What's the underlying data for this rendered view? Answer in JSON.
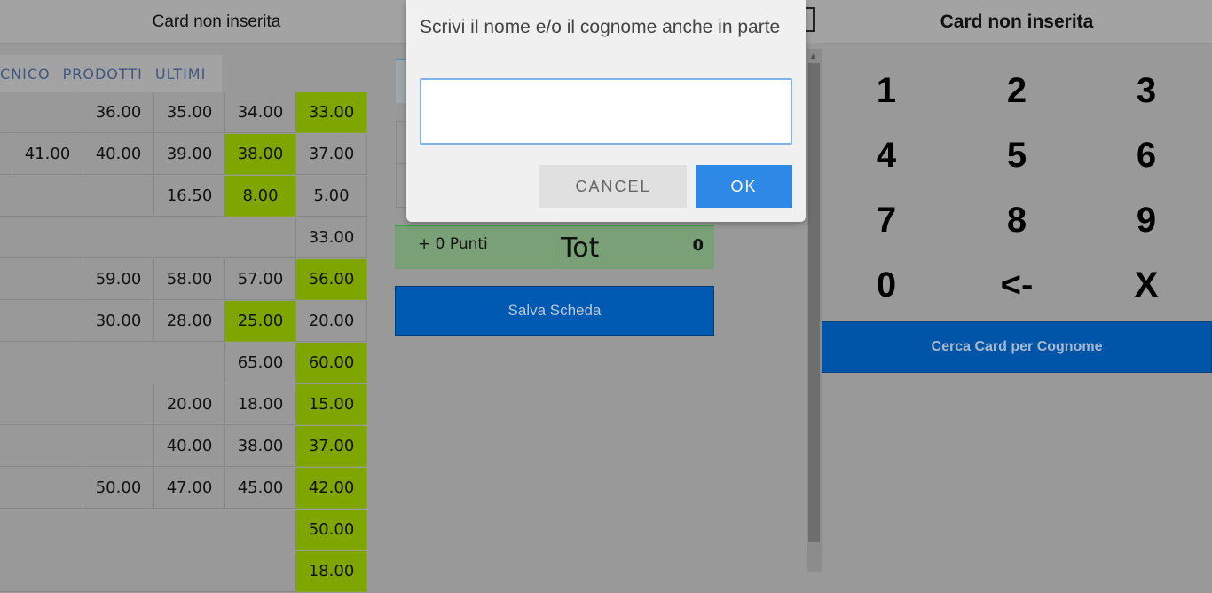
{
  "left_header": {
    "title": "Card non inserita"
  },
  "tabs": [
    "CNICO",
    "PRODOTTI",
    "ULTIMI"
  ],
  "price_rows": [
    [
      {
        "v": "36.00",
        "c": 2
      },
      {
        "v": "35.00",
        "c": 3
      },
      {
        "v": "34.00",
        "c": 4
      },
      {
        "v": "33.00",
        "c": 5,
        "hl": true
      }
    ],
    [
      {
        "v": "41.00",
        "c": 1
      },
      {
        "v": "40.00",
        "c": 2
      },
      {
        "v": "39.00",
        "c": 3
      },
      {
        "v": "38.00",
        "c": 4,
        "hl": true
      },
      {
        "v": "37.00",
        "c": 5
      }
    ],
    [
      {
        "v": "16.50",
        "c": 3
      },
      {
        "v": "8.00",
        "c": 4,
        "hl": true
      },
      {
        "v": "5.00",
        "c": 5
      }
    ],
    [
      {
        "v": "33.00",
        "c": 5
      }
    ],
    [
      {
        "v": "59.00",
        "c": 2
      },
      {
        "v": "58.00",
        "c": 3
      },
      {
        "v": "57.00",
        "c": 4
      },
      {
        "v": "56.00",
        "c": 5,
        "hl": true
      }
    ],
    [
      {
        "v": "30.00",
        "c": 2
      },
      {
        "v": "28.00",
        "c": 3
      },
      {
        "v": "25.00",
        "c": 4,
        "hl": true
      },
      {
        "v": "20.00",
        "c": 5
      }
    ],
    [
      {
        "v": "65.00",
        "c": 4
      },
      {
        "v": "60.00",
        "c": 5,
        "hl": true
      }
    ],
    [
      {
        "v": "20.00",
        "c": 3
      },
      {
        "v": "18.00",
        "c": 4
      },
      {
        "v": "15.00",
        "c": 5,
        "hl": true
      }
    ],
    [
      {
        "v": "40.00",
        "c": 3
      },
      {
        "v": "38.00",
        "c": 4
      },
      {
        "v": "37.00",
        "c": 5,
        "hl": true
      }
    ],
    [
      {
        "v": "50.00",
        "c": 2
      },
      {
        "v": "47.00",
        "c": 3
      },
      {
        "v": "45.00",
        "c": 4
      },
      {
        "v": "42.00",
        "c": 5,
        "hl": true
      }
    ],
    [
      {
        "v": "50.00",
        "c": 5,
        "hl": true
      }
    ],
    [
      {
        "v": "18.00",
        "c": 5,
        "hl": true
      }
    ]
  ],
  "points": {
    "label": "+ 0 Punti",
    "tot_label": "Tot",
    "tot_value": "0"
  },
  "save_button": "Salva Scheda",
  "right_header": {
    "title": "Card non inserita"
  },
  "keypad": [
    "1",
    "2",
    "3",
    "4",
    "5",
    "6",
    "7",
    "8",
    "9",
    "0",
    "<-",
    "X"
  ],
  "search_button": "Cerca Card per Cognome",
  "dialog": {
    "message": "Scrivi il nome e/o il cognome anche in parte",
    "input_value": "",
    "cancel_label": "CANCEL",
    "ok_label": "OK"
  },
  "colors": {
    "highlight": "#7fa600",
    "primary_blue": "#005ab2",
    "ok_blue": "#2e88e6"
  }
}
